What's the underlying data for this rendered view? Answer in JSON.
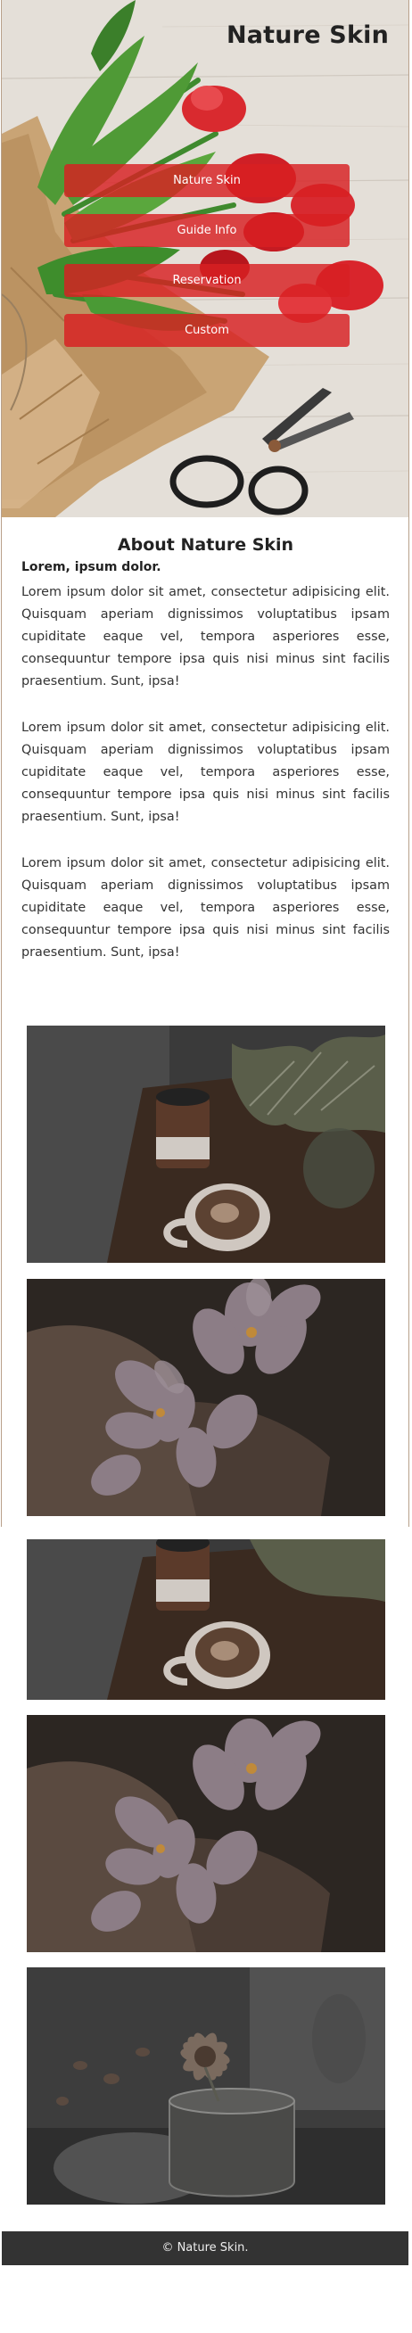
{
  "header": {
    "site_title": "Nature Skin"
  },
  "nav": {
    "items": [
      {
        "label": "Nature Skin"
      },
      {
        "label": "Guide Info"
      },
      {
        "label": "Reservation"
      },
      {
        "label": "Custom"
      }
    ]
  },
  "about": {
    "title": "About Nature Skin",
    "subtitle": "Lorem, ipsum dolor.",
    "paragraphs": [
      "Lorem ipsum dolor sit amet, consectetur adipisicing elit. Quisquam aperiam dignissimos voluptatibus ipsam cupiditate eaque vel, tempora asperiores esse, consequuntur tempore ipsa quis nisi minus sint facilis praesentium. Sunt, ipsa!",
      "Lorem ipsum dolor sit amet, consectetur adipisicing elit. Quisquam aperiam dignissimos voluptatibus ipsam cupiditate eaque vel, tempora asperiores esse, consequuntur tempore ipsa quis nisi minus sint facilis praesentium. Sunt, ipsa!",
      "Lorem ipsum dolor sit amet, consectetur adipisicing elit. Quisquam aperiam dignissimos voluptatibus ipsam cupiditate eaque vel, tempora asperiores esse, consequuntur tempore ipsa quis nisi minus sint facilis praesentium. Sunt, ipsa!"
    ]
  },
  "gallery": {
    "images": [
      {
        "subject": "coffee-and-plant-photo"
      },
      {
        "subject": "purple-crocus-flowers-photo"
      },
      {
        "subject": "coffee-and-plant-photo"
      },
      {
        "subject": "purple-crocus-flowers-photo"
      },
      {
        "subject": "dried-flower-in-glass-photo"
      }
    ]
  },
  "footer": {
    "copyright": "© Nature Skin."
  },
  "colors": {
    "menu_button": "#d82022",
    "footer_bg": "#333333",
    "title_text": "#222222"
  }
}
